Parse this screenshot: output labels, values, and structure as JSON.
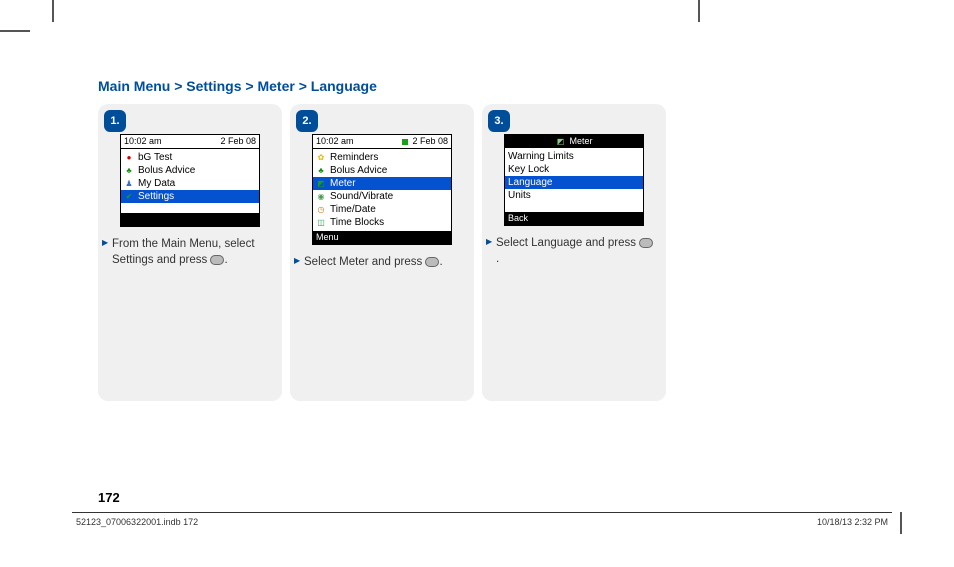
{
  "breadcrumb": "Main Menu > Settings > Meter > Language",
  "page_number": "172",
  "footer": {
    "left": "52123_07006322001.indb   172",
    "right": "10/18/13   2:32 PM"
  },
  "steps": [
    {
      "badge": "1.",
      "status": {
        "time": "10:02 am",
        "date": "2 Feb 08"
      },
      "rows": [
        {
          "icon": "drop-icon",
          "icon_char": "●",
          "label": "bG Test",
          "selected": false
        },
        {
          "icon": "bolus-icon",
          "icon_char": "♣",
          "label": "Bolus Advice",
          "selected": false
        },
        {
          "icon": "data-icon",
          "icon_char": "♟",
          "label": "My Data",
          "selected": false
        },
        {
          "icon": "check-icon",
          "icon_char": "✔",
          "label": "Settings",
          "selected": true
        }
      ],
      "footer_label": "",
      "instruction_a": "From the Main Menu, select Settings and press ",
      "instruction_b": "."
    },
    {
      "badge": "2.",
      "status": {
        "time": "10:02 am",
        "date": "2 Feb 08"
      },
      "rows": [
        {
          "icon": "bell-icon",
          "icon_char": "✿",
          "label": "Reminders",
          "selected": false
        },
        {
          "icon": "bolus-icon",
          "icon_char": "♣",
          "label": "Bolus Advice",
          "selected": false
        },
        {
          "icon": "meter-icon",
          "icon_char": "◩",
          "label": "Meter",
          "selected": true
        },
        {
          "icon": "sound-icon",
          "icon_char": "◉",
          "label": "Sound/Vibrate",
          "selected": false
        },
        {
          "icon": "clock-icon",
          "icon_char": "◷",
          "label": "Time/Date",
          "selected": false
        },
        {
          "icon": "blocks-icon",
          "icon_char": "◫",
          "label": "Time Blocks",
          "selected": false
        }
      ],
      "footer_label": "Menu",
      "instruction_a": "Select Meter and press ",
      "instruction_b": "."
    },
    {
      "badge": "3.",
      "title_icon": "meter-icon",
      "title": "Meter",
      "rows": [
        {
          "label": "Warning Limits",
          "selected": false
        },
        {
          "label": "Key Lock",
          "selected": false
        },
        {
          "label": "Language",
          "selected": true
        },
        {
          "label": "Units",
          "selected": false
        }
      ],
      "footer_label": "Back",
      "instruction_a": "Select Language and press ",
      "instruction_b": "."
    }
  ]
}
